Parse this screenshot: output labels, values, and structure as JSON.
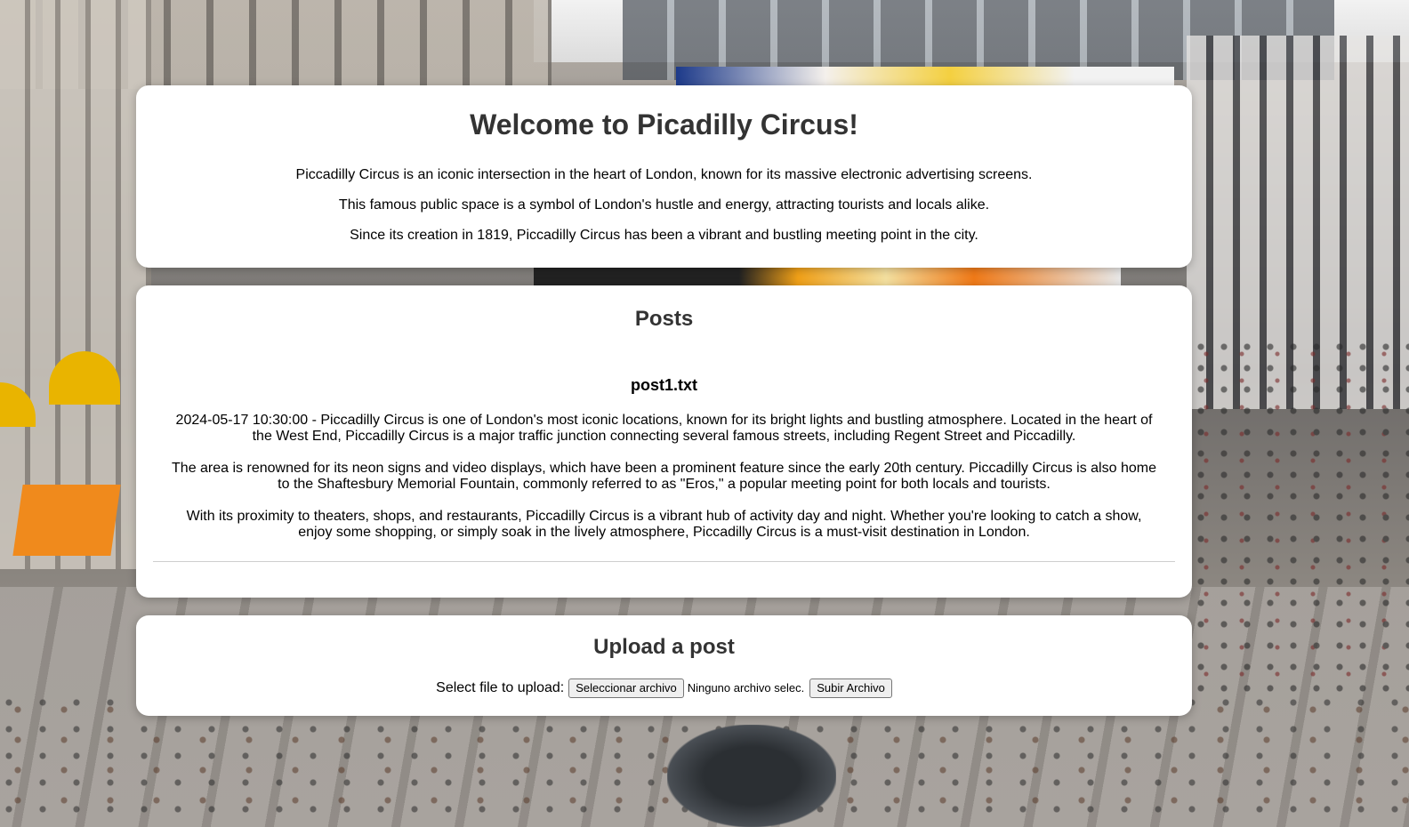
{
  "welcome": {
    "title": "Welcome to Picadilly Circus!",
    "paragraphs": [
      "Piccadilly Circus is an iconic intersection in the heart of London, known for its massive electronic advertising screens.",
      "This famous public space is a symbol of London's hustle and energy, attracting tourists and locals alike.",
      "Since its creation in 1819, Piccadilly Circus has been a vibrant and bustling meeting point in the city."
    ]
  },
  "posts": {
    "heading": "Posts",
    "items": [
      {
        "filename": "post1.txt",
        "paragraphs": [
          "2024-05-17 10:30:00 - Piccadilly Circus is one of London's most iconic locations, known for its bright lights and bustling atmosphere. Located in the heart of the West End, Piccadilly Circus is a major traffic junction connecting several famous streets, including Regent Street and Piccadilly.",
          "The area is renowned for its neon signs and video displays, which have been a prominent feature since the early 20th century. Piccadilly Circus is also home to the Shaftesbury Memorial Fountain, commonly referred to as \"Eros,\" a popular meeting point for both locals and tourists.",
          "With its proximity to theaters, shops, and restaurants, Piccadilly Circus is a vibrant hub of activity day and night. Whether you're looking to catch a show, enjoy some shopping, or simply soak in the lively atmosphere, Piccadilly Circus is a must-visit destination in London."
        ]
      }
    ]
  },
  "upload": {
    "heading": "Upload a post",
    "label": "Select file to upload:",
    "choose_button": "Seleccionar archivo",
    "file_status": "Ninguno archivo selec.",
    "submit_button": "Subir Archivo"
  }
}
